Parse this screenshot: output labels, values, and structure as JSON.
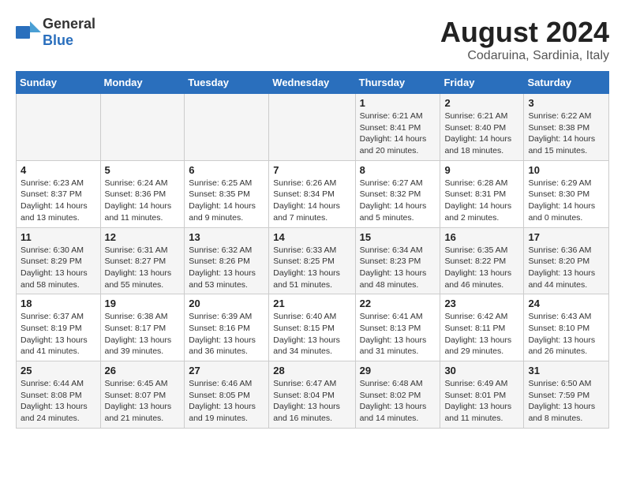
{
  "header": {
    "logo_general": "General",
    "logo_blue": "Blue",
    "month": "August 2024",
    "location": "Codaruina, Sardinia, Italy"
  },
  "days_of_week": [
    "Sunday",
    "Monday",
    "Tuesday",
    "Wednesday",
    "Thursday",
    "Friday",
    "Saturday"
  ],
  "weeks": [
    [
      {
        "day": "",
        "info": ""
      },
      {
        "day": "",
        "info": ""
      },
      {
        "day": "",
        "info": ""
      },
      {
        "day": "",
        "info": ""
      },
      {
        "day": "1",
        "info": "Sunrise: 6:21 AM\nSunset: 8:41 PM\nDaylight: 14 hours and 20 minutes."
      },
      {
        "day": "2",
        "info": "Sunrise: 6:21 AM\nSunset: 8:40 PM\nDaylight: 14 hours and 18 minutes."
      },
      {
        "day": "3",
        "info": "Sunrise: 6:22 AM\nSunset: 8:38 PM\nDaylight: 14 hours and 15 minutes."
      }
    ],
    [
      {
        "day": "4",
        "info": "Sunrise: 6:23 AM\nSunset: 8:37 PM\nDaylight: 14 hours and 13 minutes."
      },
      {
        "day": "5",
        "info": "Sunrise: 6:24 AM\nSunset: 8:36 PM\nDaylight: 14 hours and 11 minutes."
      },
      {
        "day": "6",
        "info": "Sunrise: 6:25 AM\nSunset: 8:35 PM\nDaylight: 14 hours and 9 minutes."
      },
      {
        "day": "7",
        "info": "Sunrise: 6:26 AM\nSunset: 8:34 PM\nDaylight: 14 hours and 7 minutes."
      },
      {
        "day": "8",
        "info": "Sunrise: 6:27 AM\nSunset: 8:32 PM\nDaylight: 14 hours and 5 minutes."
      },
      {
        "day": "9",
        "info": "Sunrise: 6:28 AM\nSunset: 8:31 PM\nDaylight: 14 hours and 2 minutes."
      },
      {
        "day": "10",
        "info": "Sunrise: 6:29 AM\nSunset: 8:30 PM\nDaylight: 14 hours and 0 minutes."
      }
    ],
    [
      {
        "day": "11",
        "info": "Sunrise: 6:30 AM\nSunset: 8:29 PM\nDaylight: 13 hours and 58 minutes."
      },
      {
        "day": "12",
        "info": "Sunrise: 6:31 AM\nSunset: 8:27 PM\nDaylight: 13 hours and 55 minutes."
      },
      {
        "day": "13",
        "info": "Sunrise: 6:32 AM\nSunset: 8:26 PM\nDaylight: 13 hours and 53 minutes."
      },
      {
        "day": "14",
        "info": "Sunrise: 6:33 AM\nSunset: 8:25 PM\nDaylight: 13 hours and 51 minutes."
      },
      {
        "day": "15",
        "info": "Sunrise: 6:34 AM\nSunset: 8:23 PM\nDaylight: 13 hours and 48 minutes."
      },
      {
        "day": "16",
        "info": "Sunrise: 6:35 AM\nSunset: 8:22 PM\nDaylight: 13 hours and 46 minutes."
      },
      {
        "day": "17",
        "info": "Sunrise: 6:36 AM\nSunset: 8:20 PM\nDaylight: 13 hours and 44 minutes."
      }
    ],
    [
      {
        "day": "18",
        "info": "Sunrise: 6:37 AM\nSunset: 8:19 PM\nDaylight: 13 hours and 41 minutes."
      },
      {
        "day": "19",
        "info": "Sunrise: 6:38 AM\nSunset: 8:17 PM\nDaylight: 13 hours and 39 minutes."
      },
      {
        "day": "20",
        "info": "Sunrise: 6:39 AM\nSunset: 8:16 PM\nDaylight: 13 hours and 36 minutes."
      },
      {
        "day": "21",
        "info": "Sunrise: 6:40 AM\nSunset: 8:15 PM\nDaylight: 13 hours and 34 minutes."
      },
      {
        "day": "22",
        "info": "Sunrise: 6:41 AM\nSunset: 8:13 PM\nDaylight: 13 hours and 31 minutes."
      },
      {
        "day": "23",
        "info": "Sunrise: 6:42 AM\nSunset: 8:11 PM\nDaylight: 13 hours and 29 minutes."
      },
      {
        "day": "24",
        "info": "Sunrise: 6:43 AM\nSunset: 8:10 PM\nDaylight: 13 hours and 26 minutes."
      }
    ],
    [
      {
        "day": "25",
        "info": "Sunrise: 6:44 AM\nSunset: 8:08 PM\nDaylight: 13 hours and 24 minutes."
      },
      {
        "day": "26",
        "info": "Sunrise: 6:45 AM\nSunset: 8:07 PM\nDaylight: 13 hours and 21 minutes."
      },
      {
        "day": "27",
        "info": "Sunrise: 6:46 AM\nSunset: 8:05 PM\nDaylight: 13 hours and 19 minutes."
      },
      {
        "day": "28",
        "info": "Sunrise: 6:47 AM\nSunset: 8:04 PM\nDaylight: 13 hours and 16 minutes."
      },
      {
        "day": "29",
        "info": "Sunrise: 6:48 AM\nSunset: 8:02 PM\nDaylight: 13 hours and 14 minutes."
      },
      {
        "day": "30",
        "info": "Sunrise: 6:49 AM\nSunset: 8:01 PM\nDaylight: 13 hours and 11 minutes."
      },
      {
        "day": "31",
        "info": "Sunrise: 6:50 AM\nSunset: 7:59 PM\nDaylight: 13 hours and 8 minutes."
      }
    ]
  ]
}
